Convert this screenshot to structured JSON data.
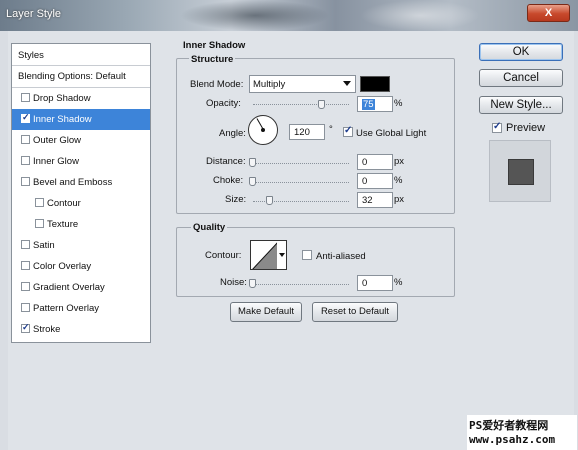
{
  "window": {
    "title": "Layer Style",
    "close_label": "X"
  },
  "styles_panel": {
    "header": "Styles",
    "blending_options": "Blending Options: Default",
    "items": [
      {
        "label": "Drop Shadow",
        "checked": false,
        "selected": false,
        "sub": false
      },
      {
        "label": "Inner Shadow",
        "checked": true,
        "selected": true,
        "sub": false
      },
      {
        "label": "Outer Glow",
        "checked": false,
        "selected": false,
        "sub": false
      },
      {
        "label": "Inner Glow",
        "checked": false,
        "selected": false,
        "sub": false
      },
      {
        "label": "Bevel and Emboss",
        "checked": false,
        "selected": false,
        "sub": false
      },
      {
        "label": "Contour",
        "checked": false,
        "selected": false,
        "sub": true
      },
      {
        "label": "Texture",
        "checked": false,
        "selected": false,
        "sub": true
      },
      {
        "label": "Satin",
        "checked": false,
        "selected": false,
        "sub": false
      },
      {
        "label": "Color Overlay",
        "checked": false,
        "selected": false,
        "sub": false
      },
      {
        "label": "Gradient Overlay",
        "checked": false,
        "selected": false,
        "sub": false
      },
      {
        "label": "Pattern Overlay",
        "checked": false,
        "selected": false,
        "sub": false
      },
      {
        "label": "Stroke",
        "checked": true,
        "selected": false,
        "sub": false
      }
    ]
  },
  "inner_shadow": {
    "title": "Inner Shadow",
    "structure": {
      "title": "Structure",
      "blend_mode_label": "Blend Mode:",
      "blend_mode_value": "Multiply",
      "shadow_color": "#000000",
      "opacity_label": "Opacity:",
      "opacity_value": "75",
      "opacity_unit": "%",
      "angle_label": "Angle:",
      "angle_value": "120",
      "angle_unit": "°",
      "use_global_light_label": "Use Global Light",
      "use_global_light_checked": true,
      "distance_label": "Distance:",
      "distance_value": "0",
      "distance_unit": "px",
      "choke_label": "Choke:",
      "choke_value": "0",
      "choke_unit": "%",
      "size_label": "Size:",
      "size_value": "32",
      "size_unit": "px"
    },
    "quality": {
      "title": "Quality",
      "contour_label": "Contour:",
      "anti_aliased_label": "Anti-aliased",
      "anti_aliased_checked": false,
      "noise_label": "Noise:",
      "noise_value": "0",
      "noise_unit": "%"
    },
    "make_default_label": "Make Default",
    "reset_default_label": "Reset to Default"
  },
  "actions": {
    "ok_label": "OK",
    "cancel_label": "Cancel",
    "new_style_label": "New Style...",
    "preview_label": "Preview",
    "preview_checked": true
  },
  "watermark": {
    "line1": "PS爱好者教程网",
    "line2": "www.psahz.com"
  },
  "colors": {
    "selection": "#3d84d9",
    "dialog_bg": "#dfe3e8",
    "close_button": "#c8492c"
  }
}
